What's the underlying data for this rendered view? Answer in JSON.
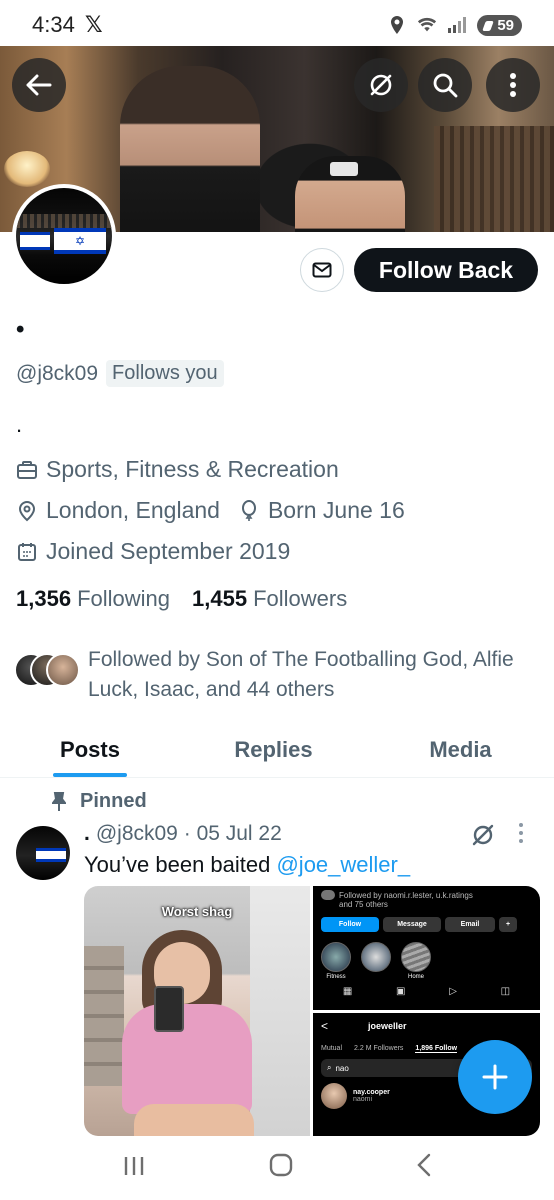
{
  "status_bar": {
    "time": "4:34",
    "x_logo": "𝕏",
    "battery": "59"
  },
  "header": {
    "back_icon": "arrow-left-icon",
    "grok_icon": "grok-icon",
    "search_icon": "search-icon",
    "more_icon": "more-vertical-icon"
  },
  "profile": {
    "display_name": "•",
    "handle": "@j8ck09",
    "follows_you": "Follows you",
    "bio": ".",
    "category": "Sports, Fitness & Recreation",
    "location": "London, England",
    "birthday": "Born June 16",
    "joined": "Joined September 2019",
    "following_count": "1,356",
    "following_label": "Following",
    "followers_count": "1,455",
    "followers_label": "Followers",
    "followed_by": "Followed by Son of The Footballing God, Alfie Luck, Isaac, and 44 others"
  },
  "actions": {
    "follow_back": "Follow Back"
  },
  "tabs": [
    {
      "label": "Posts",
      "active": true
    },
    {
      "label": "Replies",
      "active": false
    },
    {
      "label": "Media",
      "active": false
    }
  ],
  "post": {
    "pinned_label": "Pinned",
    "author_name": ".",
    "handle": "@j8ck09",
    "date": "05 Jul 22",
    "text": "You’ve been baited ",
    "mention": "@joe_weller_",
    "media_left_caption": "Worst shag",
    "media_right_top": {
      "followed_by": "Followed by naomi.r.lester, u.k.ratings",
      "and_others": "and 75 others",
      "follow": "Follow",
      "message": "Message",
      "email": "Email",
      "highlights": [
        "Fitness",
        "",
        "Home"
      ]
    },
    "media_right_bottom": {
      "username": "joeweller",
      "tabs": [
        "Mutual",
        "2.2 M Followers",
        "1,896 Follow"
      ],
      "search_value": "nao",
      "result_name": "nay.cooper",
      "result_sub": "naomi"
    }
  },
  "colors": {
    "accent": "#1d9bf0",
    "text_primary": "#0f1419",
    "text_secondary": "#536471"
  }
}
